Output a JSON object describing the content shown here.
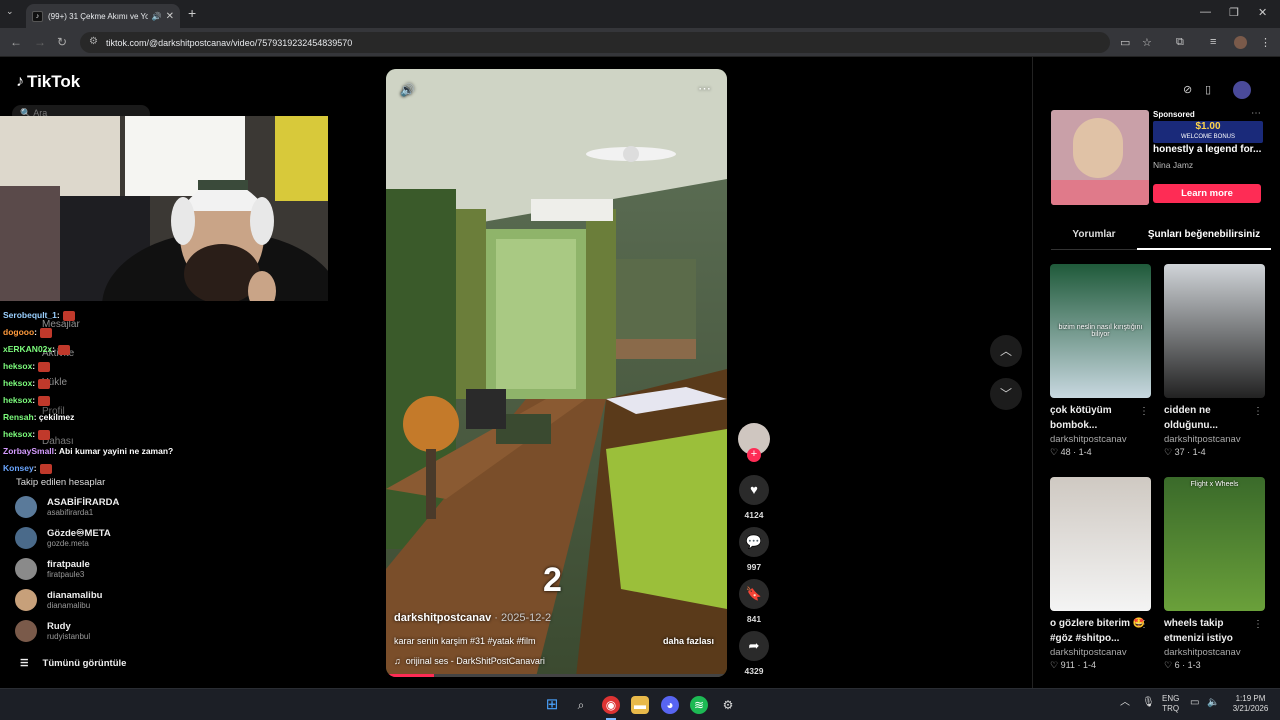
{
  "browser": {
    "tab_title": "(99+) 31 Çekme Akımı ve Yo",
    "url": "tiktok.com/@darkshitpostcanav/video/7579319232454839570"
  },
  "tiktok": {
    "logo": "TikTok",
    "search_placeholder": "Ara",
    "menu": [
      "Mesajlar",
      "Aktivite",
      "Yükle",
      "Profil",
      "Dahası"
    ]
  },
  "chat": [
    {
      "user": "Serobeqult_1",
      "msg": ":",
      "color": "#9ad0ff"
    },
    {
      "user": "dogooo",
      "msg": ":",
      "color": "#ff9a3c"
    },
    {
      "user": "xERKAN02x",
      "msg": ":",
      "color": "#7cfc7c"
    },
    {
      "user": "heksox",
      "msg": ":",
      "color": "#7cfc7c"
    },
    {
      "user": "heksox",
      "msg": ":",
      "color": "#7cfc7c"
    },
    {
      "user": "heksox",
      "msg": ":",
      "color": "#7cfc7c"
    },
    {
      "user": "Rensah",
      "msg": ": çekilmez",
      "color": "#7cfc7c"
    },
    {
      "user": "heksox",
      "msg": ":",
      "color": "#7cfc7c"
    },
    {
      "user": "ZorbaySmall",
      "msg": ": Abi kumar yayini ne zaman?",
      "color": "#d59cff"
    },
    {
      "user": "Konsey",
      "msg": ":",
      "color": "#6aa6ff"
    }
  ],
  "following": {
    "heading": "Takip edilen hesaplar",
    "accounts": [
      {
        "name": "ASABİFİRARDA",
        "handle": "asabifirarda1",
        "color": "#5a7a9a"
      },
      {
        "name": "Gözde♾META",
        "handle": "gozde.meta",
        "color": "#4a6a8a"
      },
      {
        "name": "firatpaule",
        "handle": "firatpaule3",
        "color": "#8a8a8a"
      },
      {
        "name": "dianamalibu",
        "handle": "dianamalibu",
        "color": "#c7a07a"
      },
      {
        "name": "Rudy",
        "handle": "rudyistanbul",
        "color": "#7a5a4a"
      }
    ],
    "see_all": "Tümünü görüntüle"
  },
  "video": {
    "author": "darkshitpostcanav",
    "date": "· 2025-12-2",
    "caption": "karar senin karşim #31 #yatak #film",
    "more": "daha fazlası",
    "sound": "orijinal ses - DarkShitPostCanavari",
    "overlay_number": "2",
    "likes": "4124",
    "comments": "997",
    "saves": "841",
    "shares": "4329"
  },
  "right_panel": {
    "ad": {
      "sponsored": "Sponsored",
      "title": "honestly a legend for...",
      "author": "Nina Jamz",
      "cta": "Learn more",
      "bonus": "$1.00",
      "bonus_sub": "WELCOME BONUS"
    },
    "tabs": [
      "Yorumlar",
      "Şunları beğenebilirsiniz"
    ],
    "cards": [
      {
        "title": "çok kötüyüm bombok...",
        "author": "darkshitpostcanav",
        "likes": "48",
        "ep": "1-4",
        "overlay": "bizim neslin nasıl kırıştığını biliyor"
      },
      {
        "title": "cidden ne olduğunu...",
        "author": "darkshitpostcanav",
        "likes": "37",
        "ep": "1-4",
        "overlay": ""
      },
      {
        "title": "o gözlere biterim 🤩 #göz #shitpo...",
        "author": "darkshitpostcanav",
        "likes": "911",
        "ep": "1-4",
        "overlay": ""
      },
      {
        "title": "wheels takip etmenizi istiyo",
        "author": "darkshitpostcanav",
        "likes": "6",
        "ep": "1-3",
        "overlay": "Flight x Wheels"
      }
    ]
  },
  "taskbar": {
    "lang": "ENG",
    "lang2": "TRQ",
    "time": "1:19 PM",
    "date": "3/21/2026"
  }
}
